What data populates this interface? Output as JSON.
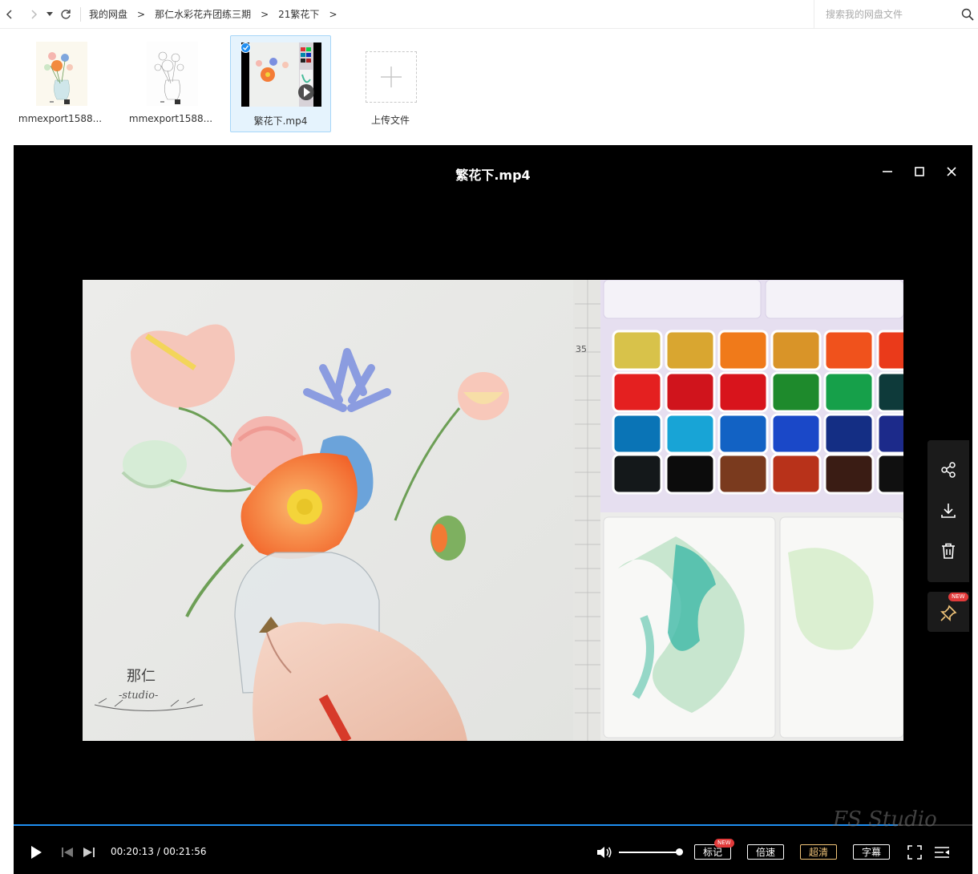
{
  "nav": {
    "breadcrumbs": [
      "我的网盘",
      "那仁水彩花卉团练三期",
      "21繁花下"
    ],
    "separator": ">"
  },
  "search": {
    "placeholder": "搜索我的网盘文件"
  },
  "files": [
    {
      "name": "mmexport1588...",
      "type": "image"
    },
    {
      "name": "mmexport1588...",
      "type": "image"
    },
    {
      "name": "繁花下.mp4",
      "type": "video",
      "selected": true
    }
  ],
  "upload": {
    "label": "上传文件"
  },
  "player": {
    "title": "繁花下.mp4",
    "current_time": "00:20:13",
    "total_time": "00:21:56",
    "time_separator": " / ",
    "progress": 0.922,
    "volume": 1.0,
    "buttons": {
      "mark": "标记",
      "speed": "倍速",
      "quality": "超清",
      "subtitle": "字幕"
    },
    "badges": {
      "new": "NEW"
    },
    "accent_color": "#1f8ef1",
    "quality_color": "#f3c67a"
  },
  "video_content": {
    "ruler_mark": "35",
    "signature_name": "那仁",
    "signature_studio": "-studio-"
  },
  "watermark": {
    "text": "FS Studio"
  }
}
